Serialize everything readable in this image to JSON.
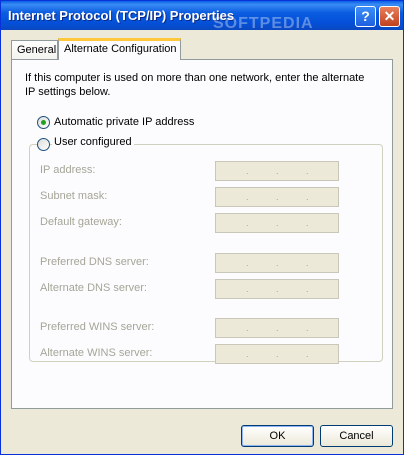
{
  "window": {
    "title": "Internet Protocol (TCP/IP) Properties",
    "watermark": "SOFTPEDIA",
    "help_label": "?",
    "close_label": "✕"
  },
  "tabs": [
    {
      "label": "General",
      "selected": false
    },
    {
      "label": "Alternate Configuration",
      "selected": true
    }
  ],
  "description": "If this computer is used on more than one network, enter the alternate IP settings below.",
  "options": {
    "automatic": {
      "label": "Automatic private IP address",
      "checked": true
    },
    "user": {
      "label": "User configured",
      "checked": false
    }
  },
  "fields": [
    {
      "label": "IP address:"
    },
    {
      "label": "Subnet mask:"
    },
    {
      "label": "Default gateway:"
    },
    {
      "label": "Preferred DNS server:"
    },
    {
      "label": "Alternate DNS server:"
    },
    {
      "label": "Preferred WINS server:"
    },
    {
      "label": "Alternate WINS server:"
    }
  ],
  "ip_dots": ".  .  .",
  "buttons": {
    "ok": "OK",
    "cancel": "Cancel"
  }
}
